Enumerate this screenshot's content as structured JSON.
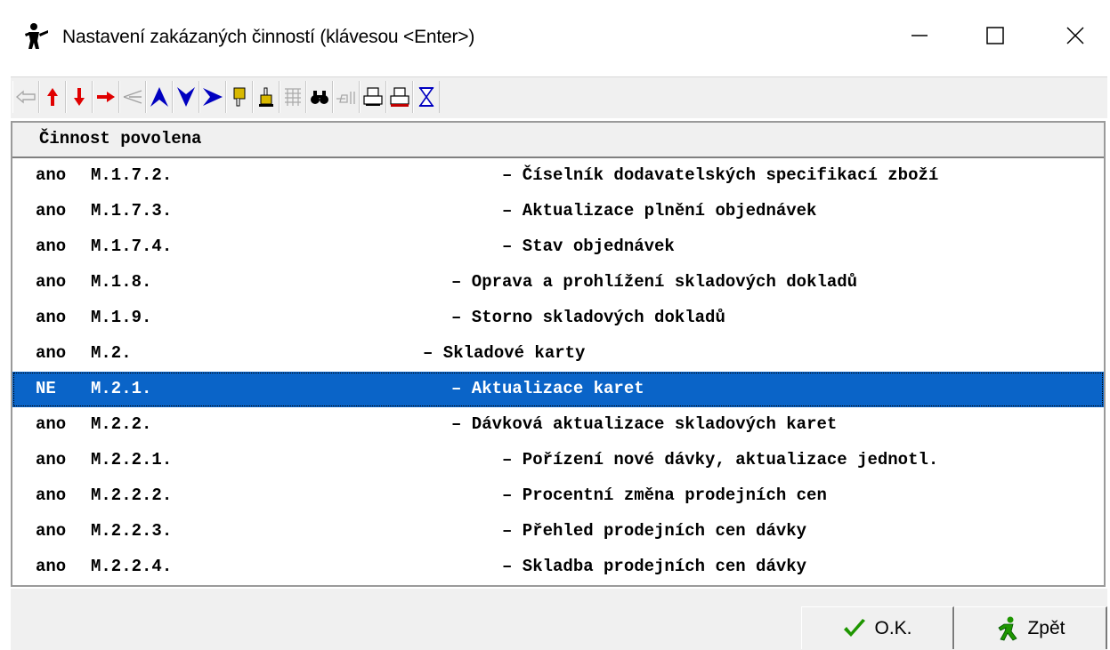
{
  "window": {
    "title": "Nastavení zakázaných činností (klávesou <Enter>)",
    "app_icon": "person-icon",
    "controls": [
      "minimize-icon",
      "maximize-icon",
      "close-icon"
    ]
  },
  "toolbar": {
    "buttons": [
      {
        "name": "back-icon",
        "color": "#b0b0b0",
        "enabled": false
      },
      {
        "name": "arrow-up-icon",
        "color": "#e00000",
        "enabled": true
      },
      {
        "name": "arrow-down-icon",
        "color": "#e00000",
        "enabled": true
      },
      {
        "name": "arrow-right-icon",
        "color": "#e00000",
        "enabled": true
      },
      {
        "name": "arrow-left-icon",
        "color": "#a0a0a0",
        "enabled": false
      },
      {
        "name": "first-record-icon",
        "color": "#0000c0",
        "enabled": true
      },
      {
        "name": "last-record-icon",
        "color": "#0000c0",
        "enabled": true
      },
      {
        "name": "next-page-icon",
        "color": "#0000c0",
        "enabled": true
      },
      {
        "name": "hand-down-icon",
        "color": "#c8a000",
        "enabled": true
      },
      {
        "name": "hand-up-icon",
        "color": "#c8a000",
        "enabled": true
      },
      {
        "name": "filter-icon",
        "color": "#a0a0a0",
        "enabled": false
      },
      {
        "name": "binoculars-icon",
        "color": "#000000",
        "enabled": true
      },
      {
        "name": "pointer-icon",
        "color": "#a0a0a0",
        "enabled": false
      },
      {
        "name": "print-icon",
        "color": "#000000",
        "enabled": true
      },
      {
        "name": "print-setup-icon",
        "color": "#c00000",
        "enabled": true
      },
      {
        "name": "hourglass-icon",
        "color": "#0000c0",
        "enabled": true
      }
    ]
  },
  "grid": {
    "header": "Činnost povolena",
    "rows": [
      {
        "flag": "ano",
        "code": "M.1.7.2.",
        "name": "– Číselník dodavatelských specifikací zboží",
        "level": 4
      },
      {
        "flag": "ano",
        "code": "M.1.7.3.",
        "name": "– Aktualizace plnění objednávek",
        "level": 4
      },
      {
        "flag": "ano",
        "code": "M.1.7.4.",
        "name": "– Stav objednávek",
        "level": 4
      },
      {
        "flag": "ano",
        "code": "M.1.8.",
        "name": "– Oprava a prohlížení skladových dokladů",
        "level": 3
      },
      {
        "flag": "ano",
        "code": "M.1.9.",
        "name": "– Storno skladových dokladů",
        "level": 3
      },
      {
        "flag": "ano",
        "code": "M.2.",
        "name": "– Skladové karty",
        "level": 2
      },
      {
        "flag": "NE",
        "code": "M.2.1.",
        "name": "– Aktualizace karet",
        "level": 3,
        "selected": true
      },
      {
        "flag": "ano",
        "code": "M.2.2.",
        "name": "– Dávková aktualizace skladových karet",
        "level": 3
      },
      {
        "flag": "ano",
        "code": "M.2.2.1.",
        "name": "– Pořízení nové dávky, aktualizace jednotl.",
        "level": 4
      },
      {
        "flag": "ano",
        "code": "M.2.2.2.",
        "name": "– Procentní změna prodejních cen",
        "level": 4
      },
      {
        "flag": "ano",
        "code": "M.2.2.3.",
        "name": "– Přehled prodejních cen dávky",
        "level": 4
      },
      {
        "flag": "ano",
        "code": "M.2.2.4.",
        "name": "– Skladba prodejních cen dávky",
        "level": 4
      }
    ]
  },
  "footer": {
    "ok_label": "O.K.",
    "ok_icon": "checkmark-icon",
    "back_label": "Zpět",
    "back_icon": "running-man-icon",
    "ok_color": "#1e9600",
    "back_color": "#1e9600"
  },
  "colors": {
    "selection": "#0a64c8",
    "chrome": "#f0f0f0"
  }
}
